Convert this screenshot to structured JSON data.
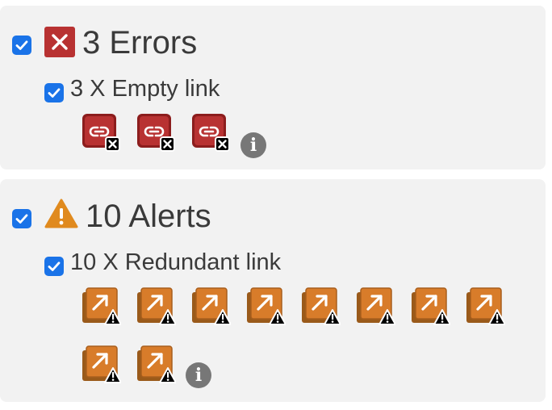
{
  "errors": {
    "heading": "3 Errors",
    "checked": true,
    "icon": "error-x-icon",
    "color": "#b83232",
    "groups": [
      {
        "label": "3 X Empty link",
        "count": 3,
        "icon": "broken-link-icon",
        "badge": "x-badge"
      }
    ]
  },
  "alerts": {
    "heading": "10 Alerts",
    "checked": true,
    "icon": "warning-triangle-icon",
    "color": "#e08a1e",
    "groups": [
      {
        "label": "10 X Redundant link",
        "count": 10,
        "icon": "redundant-link-icon",
        "badge": "warning-badge"
      }
    ]
  },
  "info_icon": "info-icon",
  "accent_color": "#1a73e8"
}
